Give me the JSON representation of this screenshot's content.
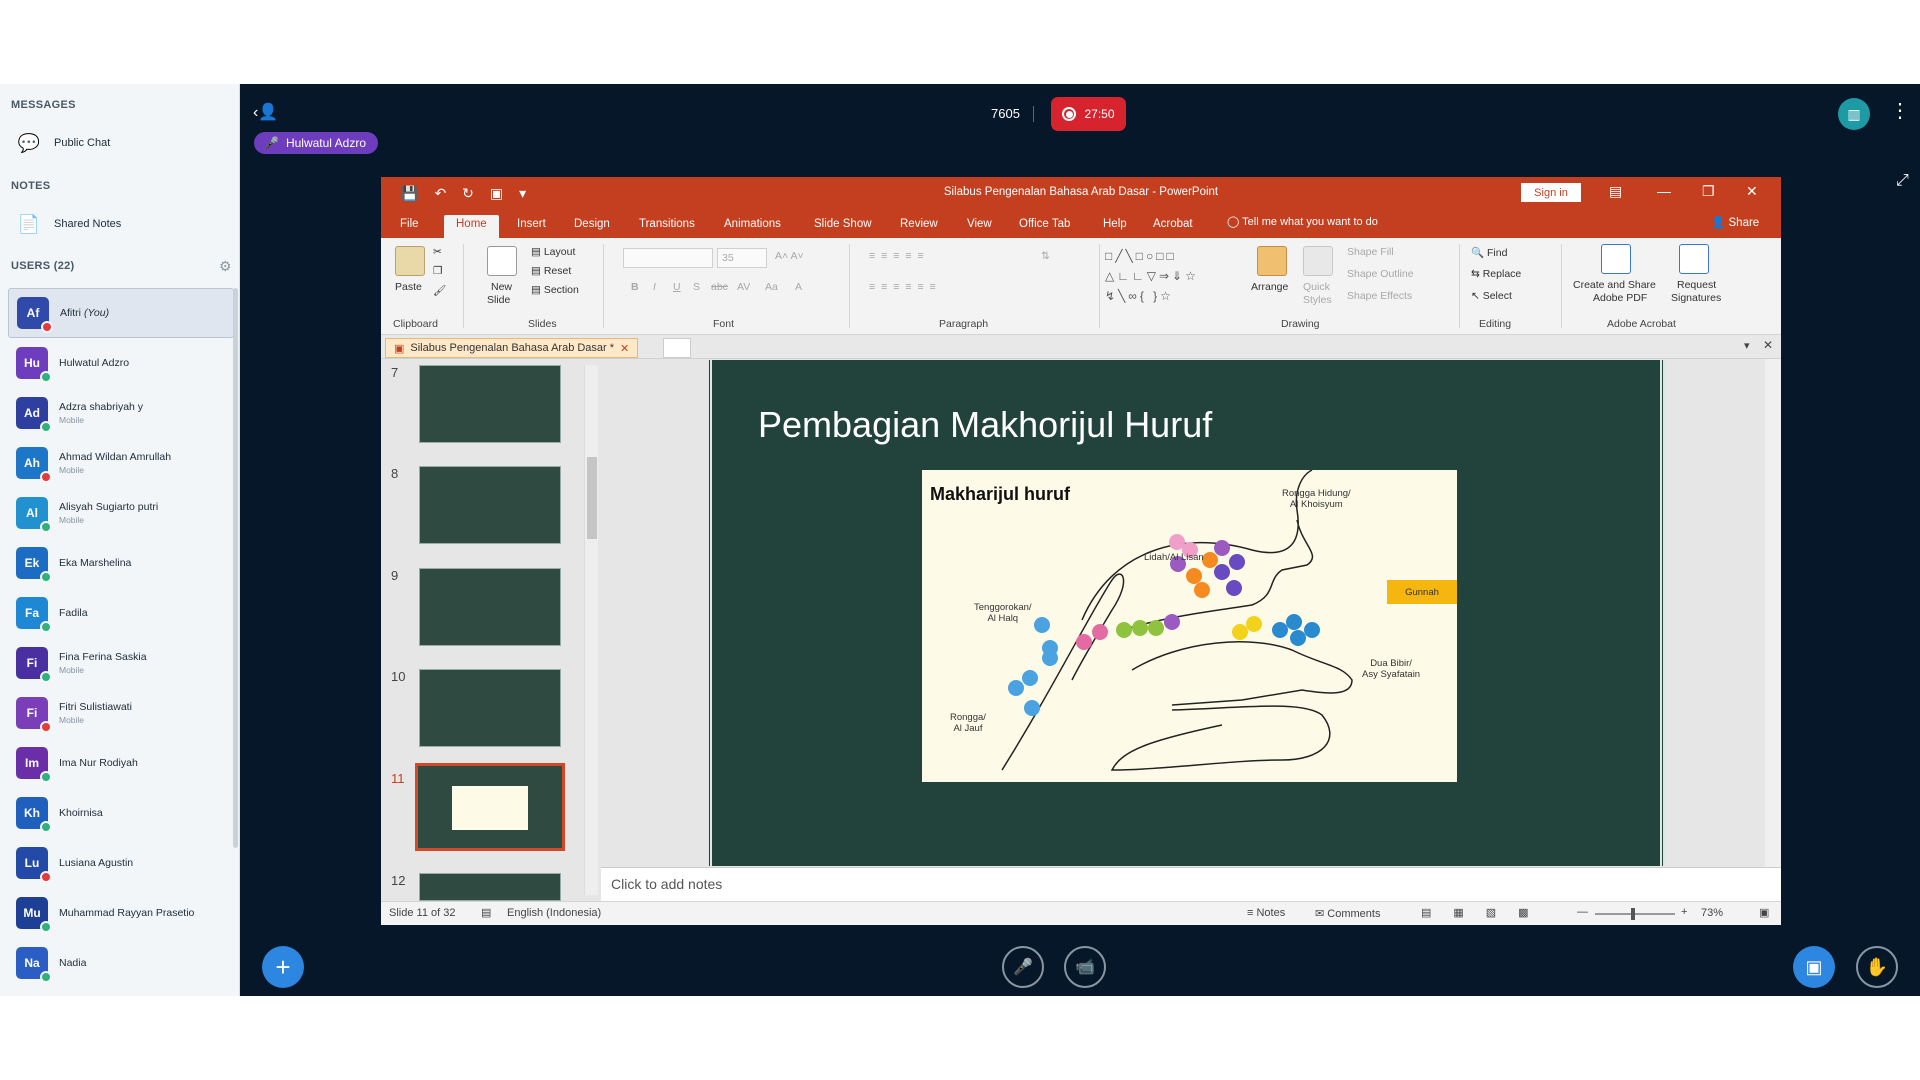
{
  "sidebar": {
    "messages_title": "MESSAGES",
    "public_chat": "Public Chat",
    "notes_title": "NOTES",
    "shared_notes": "Shared Notes",
    "users_title": "USERS (22)",
    "users": [
      {
        "initials": "Af",
        "name": "Afitri",
        "you": "(You)",
        "sub": "",
        "color": "#2f4aa8",
        "status": "#e33a3a"
      },
      {
        "initials": "Hu",
        "name": "Hulwatul Adzro",
        "sub": "",
        "color": "#6d3dbd",
        "status": "#2fb07d"
      },
      {
        "initials": "Ad",
        "name": "Adzra shabriyah y",
        "sub": "Mobile",
        "color": "#2f3f9f",
        "status": "#2fb07d"
      },
      {
        "initials": "Ah",
        "name": "Ahmad Wildan Amrullah",
        "sub": "Mobile",
        "color": "#1e76c9",
        "status": "#e33a3a"
      },
      {
        "initials": "Al",
        "name": "Alisyah Sugiarto putri",
        "sub": "Mobile",
        "color": "#2191d0",
        "status": "#2fb07d"
      },
      {
        "initials": "Ek",
        "name": "Eka Marshelina",
        "sub": "",
        "color": "#1b6cc2",
        "status": "#2fb07d"
      },
      {
        "initials": "Fa",
        "name": "Fadila",
        "sub": "",
        "color": "#1e88d4",
        "status": "#2fb07d"
      },
      {
        "initials": "Fi",
        "name": "Fina Ferina Saskia",
        "sub": "Mobile",
        "color": "#4a2fa0",
        "status": "#2fb07d"
      },
      {
        "initials": "Fi",
        "name": "Fitri Sulistiawati",
        "sub": "Mobile",
        "color": "#7a3fb8",
        "status": "#e33a3a"
      },
      {
        "initials": "Im",
        "name": "Ima Nur Rodiyah",
        "sub": "",
        "color": "#6a2fa8",
        "status": "#2fb07d"
      },
      {
        "initials": "Kh",
        "name": "Khoirnisa",
        "sub": "",
        "color": "#1f5fbe",
        "status": "#2fb07d"
      },
      {
        "initials": "Lu",
        "name": "Lusiana Agustin",
        "sub": "",
        "color": "#234aa6",
        "status": "#e33a3a"
      },
      {
        "initials": "Mu",
        "name": "Muhammad Rayyan Prasetio",
        "sub": "",
        "color": "#1e3f96",
        "status": "#2fb07d"
      },
      {
        "initials": "Na",
        "name": "Nadia",
        "sub": "",
        "color": "#2a5ec4",
        "status": "#2fb07d"
      }
    ]
  },
  "topbar": {
    "presenter": "Hulwatul Adzro",
    "room": "7605",
    "recording_time": "27:50"
  },
  "ppt": {
    "window_title": "Silabus Pengenalan Bahasa Arab Dasar - PowerPoint",
    "sign_in": "Sign in",
    "menu": [
      "File",
      "Home",
      "Insert",
      "Design",
      "Transitions",
      "Animations",
      "Slide Show",
      "Review",
      "View",
      "Office Tab",
      "Help",
      "Acrobat"
    ],
    "tell_me": "Tell me what you want to do",
    "share": "Share",
    "ribbon": {
      "paste": "Paste",
      "clipboard": "Clipboard",
      "new_slide": "New",
      "new_slide2": "Slide",
      "layout": "Layout",
      "reset": "Reset",
      "section": "Section",
      "slides": "Slides",
      "font_size": "35",
      "font": "Font",
      "paragraph": "Paragraph",
      "arrange": "Arrange",
      "quick": "Quick",
      "styles": "Styles",
      "shape_fill": "Shape Fill",
      "shape_outline": "Shape Outline",
      "shape_effects": "Shape Effects",
      "drawing": "Drawing",
      "find": "Find",
      "replace": "Replace",
      "select": "Select",
      "editing": "Editing",
      "create_share": "Create and Share",
      "adobe_pdf": "Adobe PDF",
      "request": "Request",
      "signatures": "Signatures",
      "adobe_acrobat": "Adobe Acrobat"
    },
    "doc_tab": "Silabus Pengenalan Bahasa Arab Dasar *",
    "thumbnails": [
      "7",
      "8",
      "9",
      "10",
      "11",
      "12"
    ],
    "slide": {
      "title": "Pembagian Makhorijul Huruf",
      "diagram_title": "Makharijul huruf",
      "labels": {
        "hidung": "Rongga Hidung/",
        "hidung2": "Al Khoisyum",
        "lisan": "Lidah/Al Lisan",
        "halq": "Tenggorokan/",
        "halq2": "Al Halq",
        "jauf": "Rongga/",
        "jauf2": "Al Jauf",
        "gunnah": "Gunnah",
        "syafatain": "Dua Bibir/",
        "syafatain2": "Asy Syafatain"
      }
    },
    "notes": "Click to add notes",
    "status": {
      "slide": "Slide 11 of 32",
      "language": "English (Indonesia)",
      "notes": "Notes",
      "comments": "Comments",
      "zoom": "73%"
    }
  }
}
